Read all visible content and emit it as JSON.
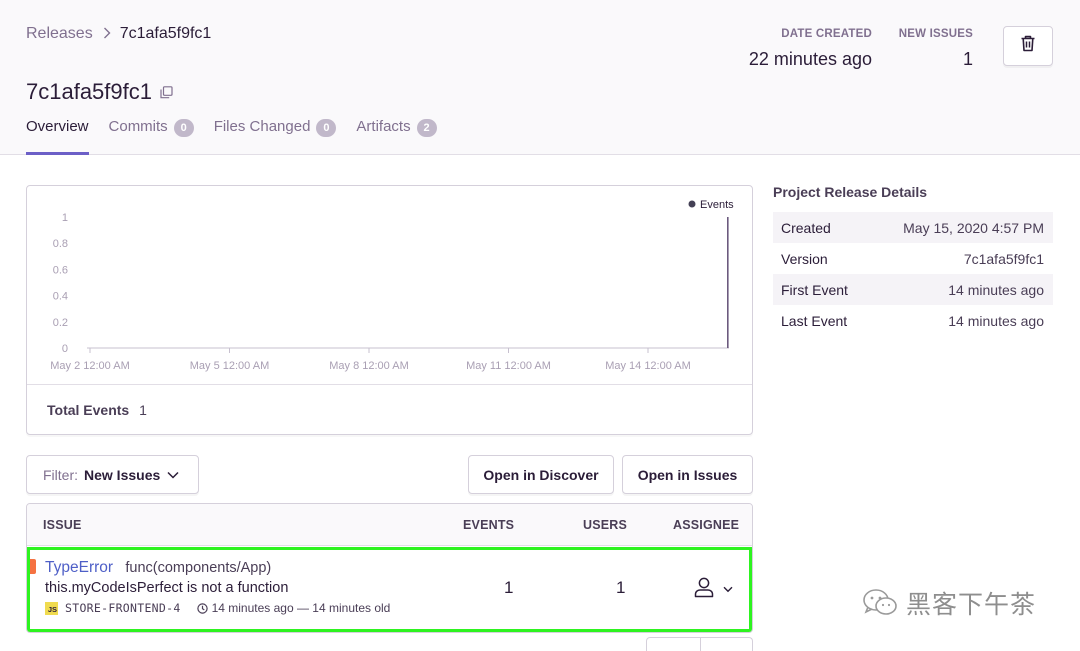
{
  "breadcrumb": {
    "root": "Releases",
    "current": "7c1afa5f9fc1"
  },
  "page_title": "7c1afa5f9fc1",
  "stats": {
    "date_created_label": "DATE CREATED",
    "date_created_value": "22 minutes ago",
    "new_issues_label": "NEW ISSUES",
    "new_issues_value": "1"
  },
  "tabs": [
    {
      "label": "Overview",
      "badge": ""
    },
    {
      "label": "Commits",
      "badge": "0"
    },
    {
      "label": "Files Changed",
      "badge": "0"
    },
    {
      "label": "Artifacts",
      "badge": "2"
    }
  ],
  "chart_data": {
    "type": "bar",
    "legend": [
      "Events"
    ],
    "legend_position": "top-right",
    "x_tick_labels": [
      "May 2 12:00 AM",
      "May 5 12:00 AM",
      "May 8 12:00 AM",
      "May 11 12:00 AM",
      "May 14 12:00 AM"
    ],
    "y_tick_labels": [
      "1",
      "0.8",
      "0.6",
      "0.4",
      "0.2",
      "0"
    ],
    "ylim": [
      0,
      1
    ],
    "series": [
      {
        "name": "Events",
        "values": [
          0,
          0,
          0,
          0,
          0,
          0,
          0,
          0,
          0,
          0,
          0,
          0,
          0,
          0,
          1
        ]
      }
    ],
    "grid": false
  },
  "total_events": {
    "label": "Total Events",
    "value": "1"
  },
  "filter": {
    "label": "Filter:",
    "value": "New Issues"
  },
  "buttons": {
    "open_discover": "Open in Discover",
    "open_issues": "Open in Issues"
  },
  "issues_table": {
    "headers": {
      "issue": "ISSUE",
      "events": "EVENTS",
      "users": "USERS",
      "assignee": "ASSIGNEE"
    },
    "rows": [
      {
        "type": "TypeError",
        "culprit": "func(components/App)",
        "message": "this.myCodeIsPerfect is not a function",
        "platform_badge": "JS",
        "short_id": "STORE-FRONTEND-4",
        "time": "14 minutes ago — 14 minutes old",
        "events": "1",
        "users": "1"
      }
    ]
  },
  "side_panel": {
    "title": "Project Release Details",
    "rows": [
      {
        "key": "Created",
        "value": "May 15, 2020 4:57 PM"
      },
      {
        "key": "Version",
        "value": "7c1afa5f9fc1"
      },
      {
        "key": "First Event",
        "value": "14 minutes ago"
      },
      {
        "key": "Last Event",
        "value": "14 minutes ago"
      }
    ]
  },
  "watermark": {
    "text": "黑客下午茶"
  },
  "colors": {
    "accent": "#6c5fc7",
    "link": "#4e5fc7",
    "error_level": "#f57242",
    "highlight": "#2ef320"
  }
}
